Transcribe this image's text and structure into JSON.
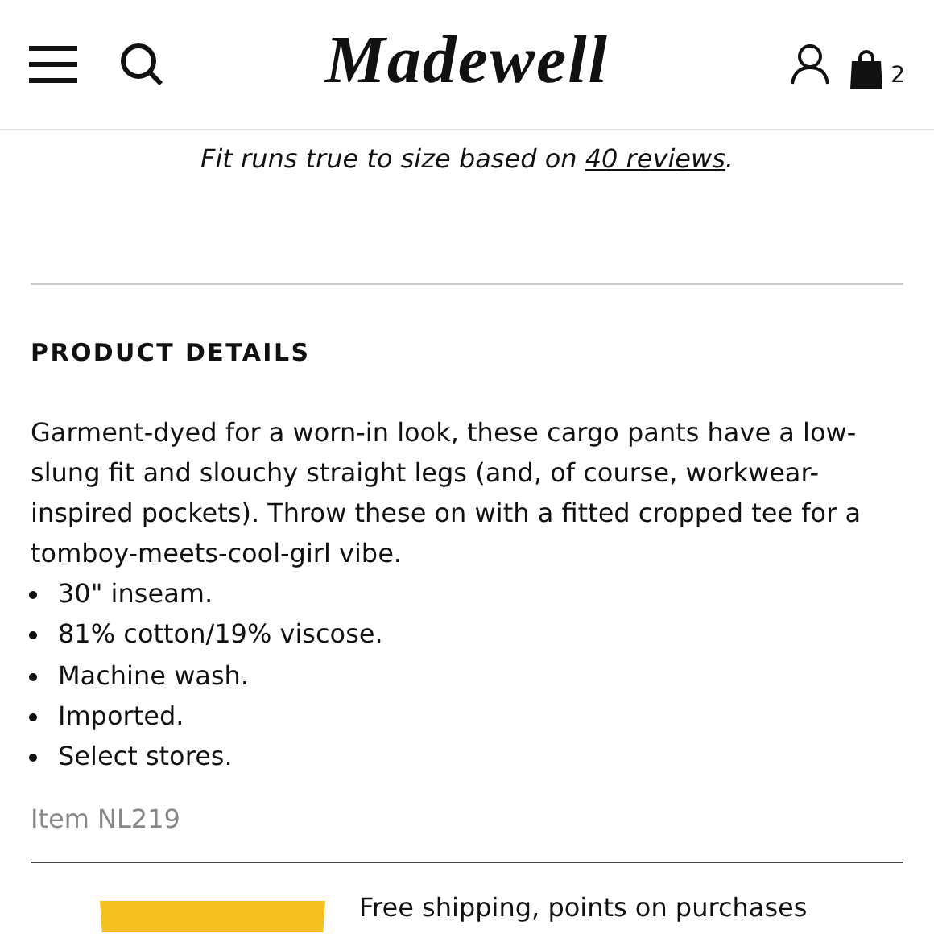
{
  "header": {
    "logo": "Madewell",
    "cart_count": "2"
  },
  "fit_note": {
    "text": "Fit runs true to size based on ",
    "link": "40 reviews",
    "end": "."
  },
  "details": {
    "heading": "PRODUCT DETAILS",
    "description": "Garment-dyed for a worn-in look, these cargo pants have a low-slung fit and slouchy straight legs (and, of course, workwear-inspired pockets). Throw these on with a fitted cropped tee for a tomboy-meets-cool-girl vibe.",
    "bullets": [
      "30\" inseam.",
      "81% cotton/19% viscose.",
      "Machine wash.",
      "Imported.",
      "Select stores."
    ],
    "item_number": "Item NL219"
  },
  "promo": {
    "text": "Free shipping, points on purchases"
  }
}
